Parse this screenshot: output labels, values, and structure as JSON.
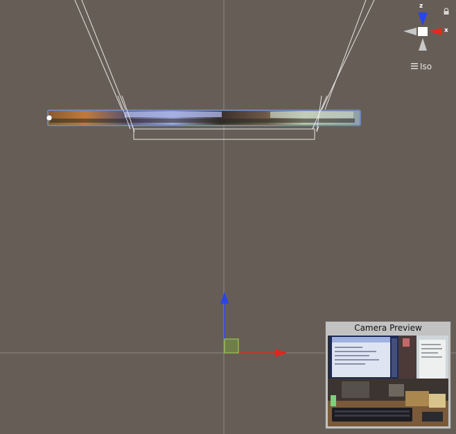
{
  "scene_view": {
    "background": "#665e56",
    "projection": "Iso",
    "projection_icon": "hamburger-menu-icon",
    "lock_icon": "lock-icon"
  },
  "orientation_gizmo": {
    "axis_y_label": "z",
    "axis_x_label": "x",
    "colors": {
      "blue_axis": "#2a44f0",
      "red_axis": "#e8271d",
      "neutral_axis": "#c8c8c8",
      "center": "#ffffff"
    }
  },
  "transform_gizmo": {
    "colors": {
      "up_arrow": "#2a44ee",
      "right_arrow": "#e0261d",
      "plane_handle": "#7c9a3a"
    }
  },
  "camera_preview": {
    "title": "Camera Preview"
  }
}
